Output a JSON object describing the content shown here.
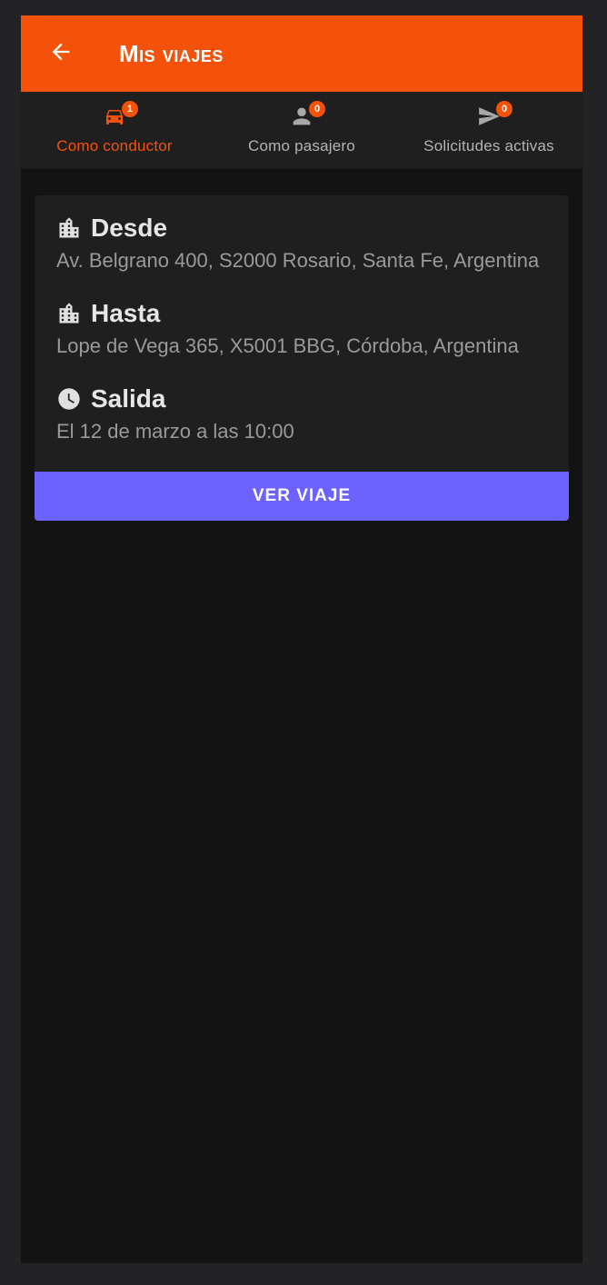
{
  "app_bar": {
    "title": "Mis viajes",
    "back_icon": "arrow-left-icon"
  },
  "tabs": [
    {
      "label": "Como conductor",
      "badge": "1",
      "icon": "car-icon",
      "active": true
    },
    {
      "label": "Como pasajero",
      "badge": "0",
      "icon": "person-icon",
      "active": false
    },
    {
      "label": "Solicitudes activas",
      "badge": "0",
      "icon": "send-icon",
      "active": false
    }
  ],
  "trips": [
    {
      "from_label": "Desde",
      "from_value": "Av. Belgrano 400, S2000 Rosario, Santa Fe, Argentina",
      "to_label": "Hasta",
      "to_value": "Lope de Vega 365, X5001 BBG, Córdoba, Argentina",
      "departure_label": "Salida",
      "departure_value": "El 12 de marzo a las 10:00",
      "action_label": "Ver viaje"
    }
  ],
  "colors": {
    "primary": "#f4510b",
    "accent": "#6c63ff",
    "background": "#131313",
    "surface": "#1f1f1f"
  }
}
